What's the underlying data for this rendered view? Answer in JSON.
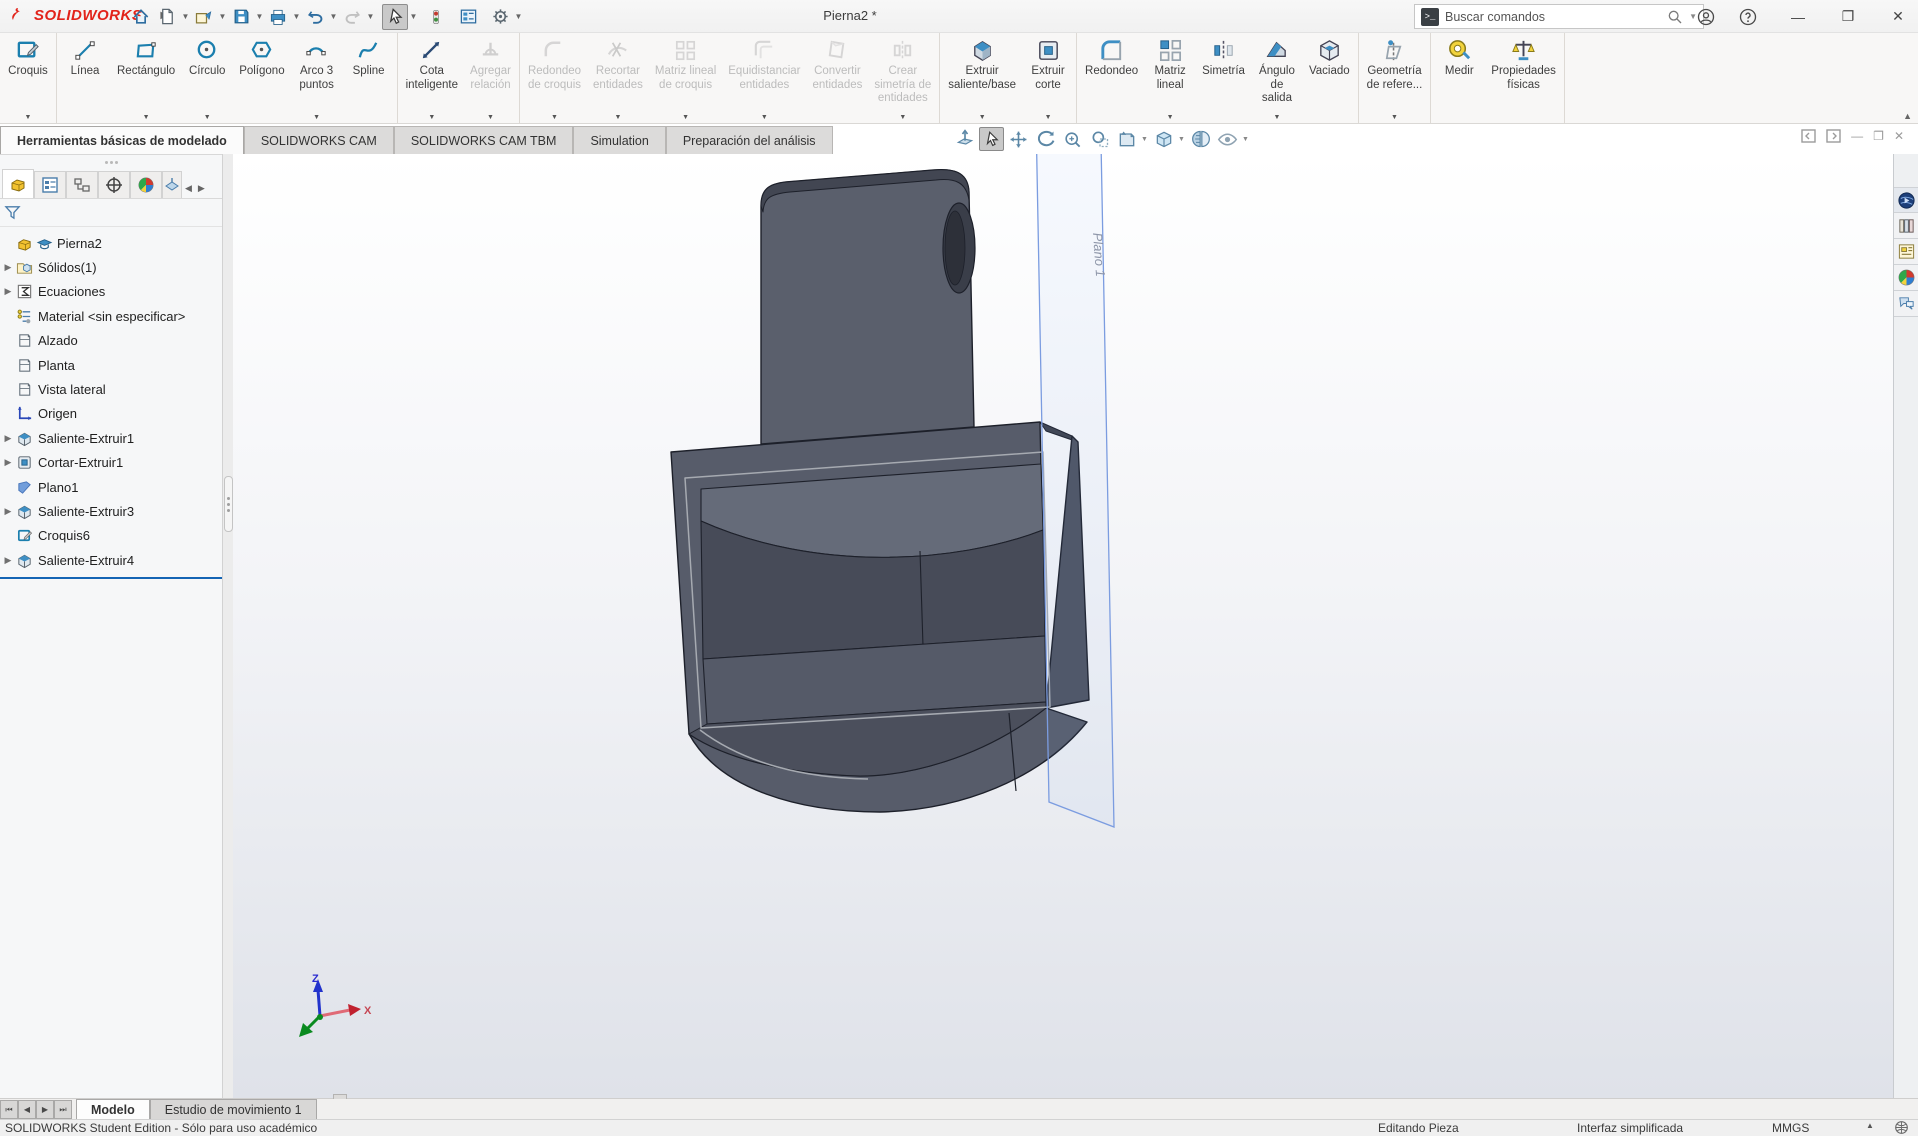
{
  "titlebar": {
    "brand": "SOLIDWORKS",
    "title": "Pierna2 *",
    "search_placeholder": "Buscar comandos"
  },
  "ribbon_tabs": [
    "Herramientas básicas de modelado",
    "SOLIDWORKS CAM",
    "SOLIDWORKS CAM TBM",
    "Simulation",
    "Preparación del análisis"
  ],
  "ribbon": {
    "groups": [
      {
        "items": [
          {
            "label": "Croquis",
            "enabled": true,
            "caret": true
          }
        ]
      },
      {
        "items": [
          {
            "label": "Línea",
            "enabled": true,
            "caret": false
          },
          {
            "label": "Rectángulo",
            "enabled": true,
            "caret": true
          },
          {
            "label": "Círculo",
            "enabled": true,
            "caret": true
          },
          {
            "label": "Polígono",
            "enabled": true,
            "caret": false
          },
          {
            "label": "Arco 3\npuntos",
            "enabled": true,
            "caret": true
          },
          {
            "label": "Spline",
            "enabled": true,
            "caret": false
          }
        ]
      },
      {
        "items": [
          {
            "label": "Cota\ninteligente",
            "enabled": true,
            "caret": true
          },
          {
            "label": "Agregar\nrelación",
            "enabled": false,
            "caret": true
          }
        ]
      },
      {
        "items": [
          {
            "label": "Redondeo\nde croquis",
            "enabled": false,
            "caret": true
          },
          {
            "label": "Recortar\nentidades",
            "enabled": false,
            "caret": true
          },
          {
            "label": "Matriz lineal\nde croquis",
            "enabled": false,
            "caret": true
          },
          {
            "label": "Equidistanciar\nentidades",
            "enabled": false,
            "caret": true
          },
          {
            "label": "Convertir\nentidades",
            "enabled": false,
            "caret": false
          },
          {
            "label": "Crear\nsimetría de\nentidades",
            "enabled": false,
            "caret": true
          }
        ]
      },
      {
        "items": [
          {
            "label": "Extruir\nsaliente/base",
            "enabled": true,
            "caret": true
          },
          {
            "label": "Extruir\ncorte",
            "enabled": true,
            "caret": true
          }
        ]
      },
      {
        "items": [
          {
            "label": "Redondeo",
            "enabled": true,
            "caret": false
          },
          {
            "label": "Matriz\nlineal",
            "enabled": true,
            "caret": true
          },
          {
            "label": "Simetría",
            "enabled": true,
            "caret": false
          },
          {
            "label": "Ángulo\nde\nsalida",
            "enabled": true,
            "caret": true
          },
          {
            "label": "Vaciado",
            "enabled": true,
            "caret": false
          }
        ]
      },
      {
        "items": [
          {
            "label": "Geometría\nde refere...",
            "enabled": true,
            "caret": true
          }
        ]
      },
      {
        "items": [
          {
            "label": "Medir",
            "enabled": true,
            "caret": false
          },
          {
            "label": "Propiedades\nfísicas",
            "enabled": true,
            "caret": false
          }
        ]
      }
    ]
  },
  "tree": {
    "items": [
      {
        "label": "Pierna2"
      },
      {
        "label": "Sólidos(1)"
      },
      {
        "label": "Ecuaciones"
      },
      {
        "label": "Material <sin especificar>"
      },
      {
        "label": "Alzado"
      },
      {
        "label": "Planta"
      },
      {
        "label": "Vista lateral"
      },
      {
        "label": "Origen"
      },
      {
        "label": "Saliente-Extruir1"
      },
      {
        "label": "Cortar-Extruir1"
      },
      {
        "label": "Plano1"
      },
      {
        "label": "Saliente-Extruir3"
      },
      {
        "label": "Croquis6"
      },
      {
        "label": "Saliente-Extruir4"
      }
    ]
  },
  "viewport": {
    "plane_label": "Plano 1",
    "triad": {
      "x": "X",
      "z": "Z"
    }
  },
  "bottom": {
    "tabs": [
      "Modelo",
      "Estudio de movimiento 1"
    ],
    "status_left": "SOLIDWORKS Student Edition - Sólo para uso académico",
    "status_editing": "Editando Pieza",
    "status_interface": "Interfaz simplificada",
    "status_units": "MMGS"
  },
  "colors": {
    "brand_red": "#E2231A",
    "plane_blue": "#7B9CE0",
    "rollback_blue": "#1464B4",
    "model_body": "#575C6A"
  }
}
